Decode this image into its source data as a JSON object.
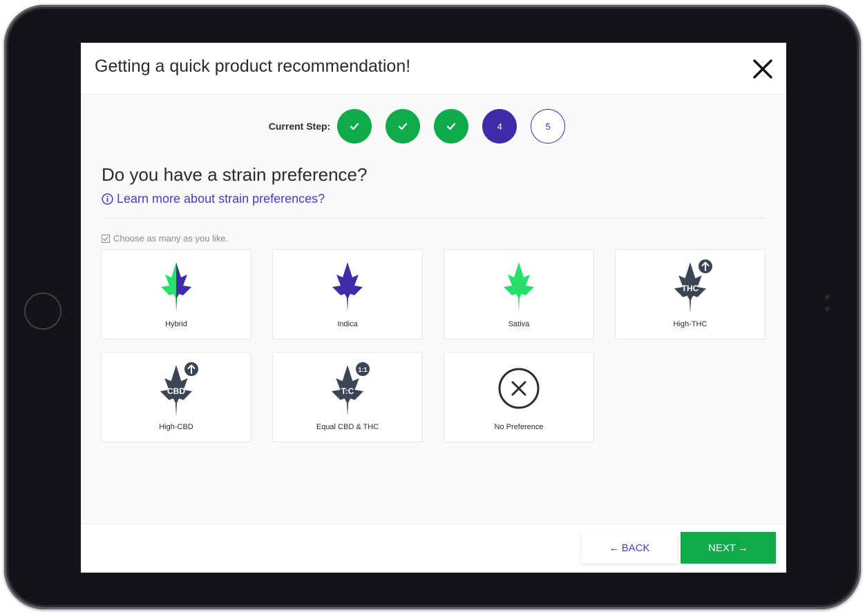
{
  "modal": {
    "title": "Getting a quick product recommendation!",
    "close_icon": "close-icon"
  },
  "stepper": {
    "label": "Current Step:",
    "steps": [
      {
        "state": "done",
        "icon": "checkmark-icon"
      },
      {
        "state": "done",
        "icon": "checkmark-icon"
      },
      {
        "state": "done",
        "icon": "checkmark-icon"
      },
      {
        "state": "current",
        "label": "4"
      },
      {
        "state": "upcoming",
        "label": "5"
      }
    ]
  },
  "question": {
    "title": "Do you have a strain preference?",
    "learn_more": "Learn more about strain preferences?",
    "hint": "Choose as many as you like."
  },
  "options": [
    {
      "label": "Hybrid",
      "icon": "hybrid-leaf-icon"
    },
    {
      "label": "Indica",
      "icon": "indica-leaf-icon"
    },
    {
      "label": "Sativa",
      "icon": "sativa-leaf-icon"
    },
    {
      "label": "High-THC",
      "icon": "high-thc-leaf-icon",
      "leaf_text": "THC"
    },
    {
      "label": "High-CBD",
      "icon": "high-cbd-leaf-icon",
      "leaf_text": "CBD"
    },
    {
      "label": "Equal CBD & THC",
      "icon": "equal-ratio-leaf-icon",
      "leaf_text": "T:C",
      "badge_text": "1:1"
    },
    {
      "label": "No Preference",
      "icon": "no-preference-icon"
    }
  ],
  "footer": {
    "back_label": "BACK",
    "next_label": "NEXT"
  },
  "colors": {
    "green": "#0faa4a",
    "purple": "#3f2aa8",
    "link": "#4a3bc6",
    "leaf_green": "#27e06a",
    "leaf_dark": "#3b4556"
  }
}
